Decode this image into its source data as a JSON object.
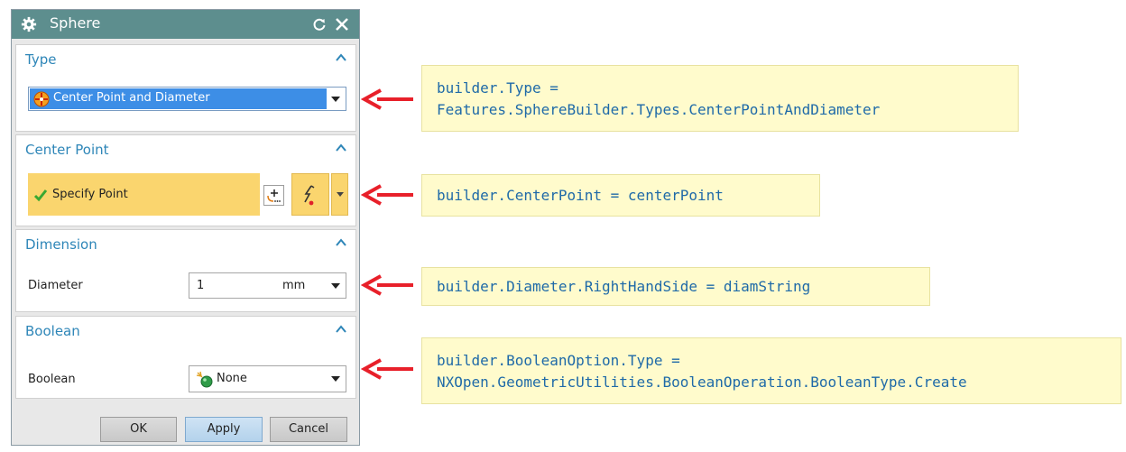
{
  "dialog": {
    "title": "Sphere",
    "icons": {
      "settings": "gear-icon",
      "reset": "reset-icon",
      "close": "close-icon"
    }
  },
  "type_section": {
    "title": "Type",
    "selected": "Center Point and Diameter"
  },
  "center_section": {
    "title": "Center Point",
    "specify_label": "Specify Point"
  },
  "dimension_section": {
    "title": "Dimension",
    "diameter_label": "Diameter",
    "diameter_value": "1",
    "unit": "mm"
  },
  "boolean_section": {
    "title": "Boolean",
    "boolean_label": "Boolean",
    "selected": "None"
  },
  "buttons": {
    "ok": "OK",
    "apply": "Apply",
    "cancel": "Cancel"
  },
  "annotations": {
    "type_line1": "builder.Type =",
    "type_line2": "Features.SphereBuilder.Types.CenterPointAndDiameter",
    "center": "builder.CenterPoint = centerPoint",
    "diameter": "builder.Diameter.RightHandSide = diamString",
    "boolean_line1": "builder.BooleanOption.Type =",
    "boolean_line2": "NXOpen.GeometricUtilities.BooleanOperation.BooleanType.Create"
  },
  "colors": {
    "titlebar": "#5d8e8e",
    "section_title": "#2e86b8",
    "highlight": "#fad56e",
    "selection": "#3d8ee6",
    "note_bg": "#fffbcc",
    "note_text": "#1f6aa8",
    "arrow": "#e8202a"
  }
}
